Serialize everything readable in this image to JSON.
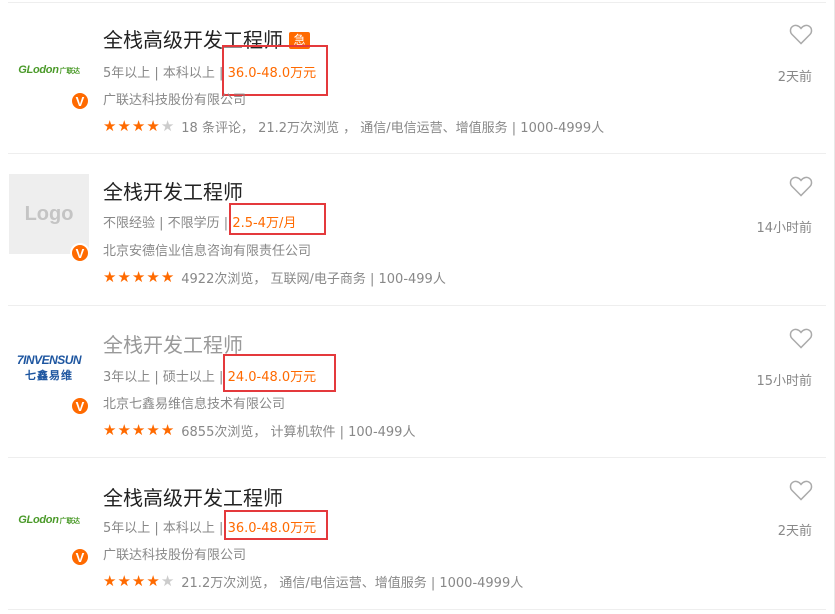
{
  "colors": {
    "accent": "#ff6a00",
    "highlight_box": "#e4393c",
    "text_gray": "#888888"
  },
  "jobs": [
    {
      "title": "全栈高级开发工程师",
      "urgent": "急",
      "requirements": "5年以上 | 本科以上 |",
      "salary": "36.0-48.0万元",
      "company": "广联达科技股份有限公司",
      "rating": 4,
      "info": "18 条评论， 21.2万次浏览 ， 通信/电信运营、增值服务 | 1000-4999人",
      "posted": "2天前",
      "logo": {
        "type": "glodon",
        "text": "GLodon",
        "sub": "广联达"
      },
      "verified": "V",
      "icons": {
        "favorite": "heart-outline-icon",
        "verified": "v-badge-icon",
        "rating": "star-icon"
      }
    },
    {
      "title": "全栈开发工程师",
      "urgent": "",
      "requirements": "不限经验 | 不限学历 |",
      "salary": "2.5-4万/月",
      "company": "北京安德信业信息咨询有限责任公司",
      "rating": 5,
      "info": "4922次浏览， 互联网/电子商务 | 100-499人",
      "posted": "14小时前",
      "logo": {
        "type": "placeholder",
        "text": "Logo"
      },
      "verified": "V",
      "icons": {
        "favorite": "heart-outline-icon",
        "verified": "v-badge-icon",
        "rating": "star-icon"
      }
    },
    {
      "title": "全栈开发工程师",
      "urgent": "",
      "requirements": "3年以上 | 硕士以上 |",
      "salary": "24.0-48.0万元",
      "company": "北京七鑫易维信息技术有限公司",
      "rating": 5,
      "info": "6855次浏览， 计算机软件 | 100-499人",
      "posted": "15小时前",
      "logo": {
        "type": "sevensun",
        "text": "7INVENSUN",
        "sub": "七鑫易维"
      },
      "verified": "V",
      "icons": {
        "favorite": "heart-outline-icon",
        "verified": "v-badge-icon",
        "rating": "star-icon"
      }
    },
    {
      "title": "全栈高级开发工程师",
      "urgent": "",
      "requirements": "5年以上 | 本科以上 |",
      "salary": "36.0-48.0万元",
      "company": "广联达科技股份有限公司",
      "rating": 4,
      "info": "21.2万次浏览， 通信/电信运营、增值服务 | 1000-4999人",
      "posted": "2天前",
      "logo": {
        "type": "glodon",
        "text": "GLodon",
        "sub": "广联达"
      },
      "verified": "V",
      "icons": {
        "favorite": "heart-outline-icon",
        "verified": "v-badge-icon",
        "rating": "star-icon"
      }
    }
  ]
}
